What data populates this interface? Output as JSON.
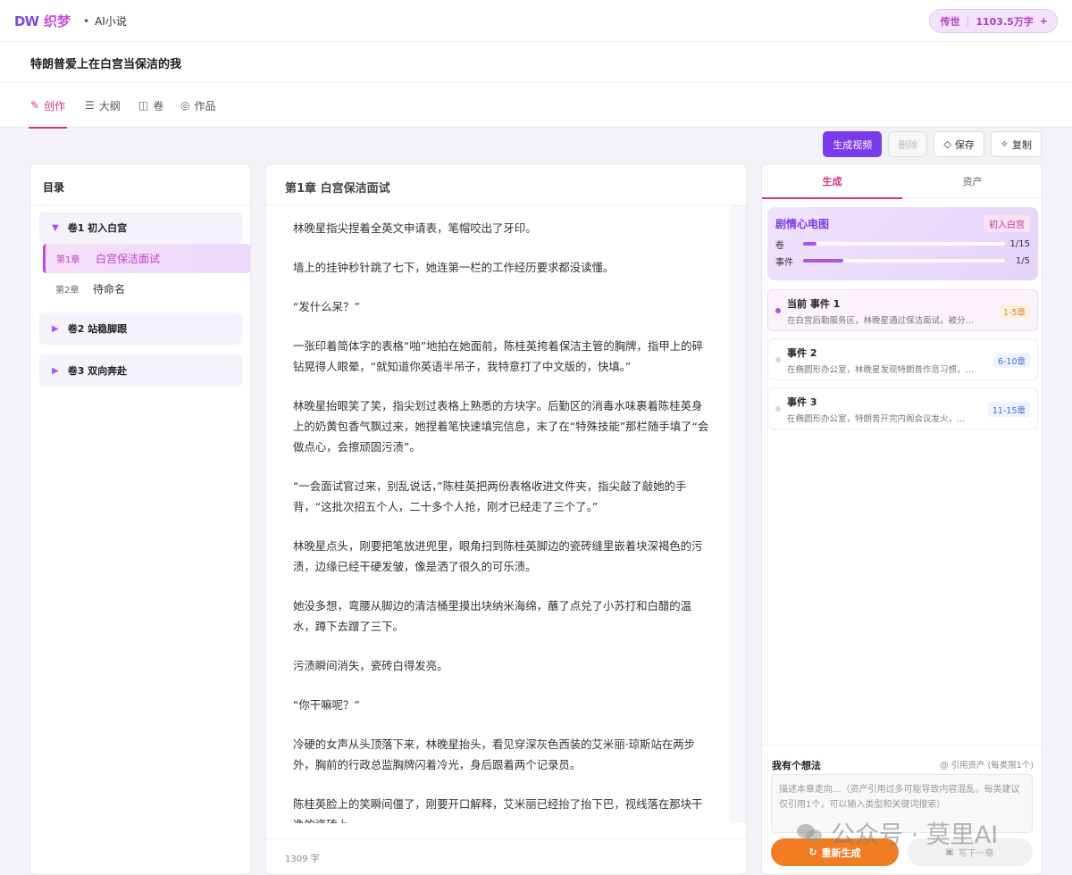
{
  "header": {
    "logo_mark": "DW",
    "logo_text": "织梦",
    "dot": "•",
    "subtitle": "AI小说",
    "quota_tier": "传世",
    "quota_sep": "|",
    "quota_value": "1103.5万字",
    "quota_plus": "+"
  },
  "novel": {
    "title": "特朗普爱上在白宫当保洁的我"
  },
  "tabs": [
    {
      "label": "创作",
      "icon": "✎",
      "icon_name": "pencil-icon"
    },
    {
      "label": "大纲",
      "icon": "☰",
      "icon_name": "list-icon"
    },
    {
      "label": "卷",
      "icon": "◫",
      "icon_name": "volume-icon"
    },
    {
      "label": "作品",
      "icon": "◎",
      "icon_name": "works-icon"
    }
  ],
  "toolbar": {
    "generate_video": "生成视频",
    "delete": "删除",
    "save": "保存",
    "save_icon": "◇",
    "copy": "复制",
    "copy_icon": "✧"
  },
  "toc": {
    "title": "目录",
    "volumes": [
      {
        "label": "卷1 初入白宫",
        "arrow": "▼"
      },
      {
        "label": "卷2 站稳脚跟",
        "arrow": "▶"
      },
      {
        "label": "卷3 双向奔赴",
        "arrow": "▶"
      }
    ],
    "chapters": [
      {
        "num": "第1章",
        "title": "白宫保洁面试"
      },
      {
        "num": "第2章",
        "title": "待命名"
      }
    ]
  },
  "editor": {
    "title": "第1章  白宫保洁面试",
    "paragraphs": [
      "林晚星指尖捏着全英文申请表，笔帽咬出了牙印。",
      "墙上的挂钟秒针跳了七下，她连第一栏的工作经历要求都没读懂。",
      "“发什么呆？”",
      "一张印着简体字的表格“啪”地拍在她面前，陈桂英挎着保洁主管的胸牌，指甲上的碎钻晃得人眼晕，“就知道你英语半吊子，我特意打了中文版的，快填。”",
      "林晚星抬眼笑了笑，指尖划过表格上熟悉的方块字。后勤区的消毒水味裹着陈桂英身上的奶黄包香气飘过来，她捏着笔快速填完信息，末了在“特殊技能”那栏随手填了“会做点心，会擦顽固污渍”。",
      "“一会面试官过来，别乱说话，”陈桂英把两份表格收进文件夹，指尖敲了敲她的手背，“这批次招五个人，二十多个人抢，刚才已经走了三个了。”",
      "林晚星点头，刚要把笔放进兜里，眼角扫到陈桂英脚边的瓷砖缝里嵌着块深褐色的污渍，边缘已经干硬发皱，像是洒了很久的可乐渍。",
      "她没多想，弯腰从脚边的清洁桶里摸出块纳米海绵，蘸了点兑了小苏打和白醋的温水，蹲下去蹭了三下。",
      "污渍瞬间消失，瓷砖白得发亮。",
      "“你干嘛呢？”",
      "冷硬的女声从头顶落下来，林晚星抬头，看见穿深灰色西装的艾米丽·琼斯站在两步外，胸前的行政总监胸牌闪着冷光，身后跟着两个记录员。",
      "陈桂英脸上的笑瞬间僵了，刚要开口解释，艾米丽已经抬了抬下巴，视线落在那块干净的瓷砖上。"
    ],
    "word_count": "1309 字"
  },
  "side": {
    "tab_generate": "生成",
    "tab_assets": "资产",
    "ecg_title": "剧情心电图",
    "ecg_tag": "初入白宫",
    "progress": [
      {
        "label": "卷",
        "value": "1/15",
        "fraction": 0.067
      },
      {
        "label": "事件",
        "value": "1/5",
        "fraction": 0.2
      }
    ],
    "events": [
      {
        "name": "当前 事件 1",
        "desc": "在白宫后勤服务区，林晚星通过保洁面试，被分…",
        "range": "1-5章"
      },
      {
        "name": "事件 2",
        "desc": "在椭圆形办公室，林晚星发现特朗普作息习惯，…",
        "range": "6-10章"
      },
      {
        "name": "事件 3",
        "desc": "在椭圆形办公室，特朗普开完内阁会议发火，…",
        "range": "11-15章"
      }
    ],
    "idea_label": "我有个想法",
    "idea_ref": "@ 引用资产 (每类限1个)",
    "idea_placeholder": "描述本章走向...（资产引用过多可能导致内容混乱，每类建议仅引用1个，可以输入类型和关键词搜索）",
    "regenerate": "重新生成",
    "regenerate_icon": "↻",
    "next_chapter": "写下一章",
    "next_icon": "▣"
  },
  "watermark": "公众号 · 莫里AI",
  "colors": {
    "accent": "#d63384",
    "primary": "#7c3aed",
    "orange": "#f07c23"
  }
}
